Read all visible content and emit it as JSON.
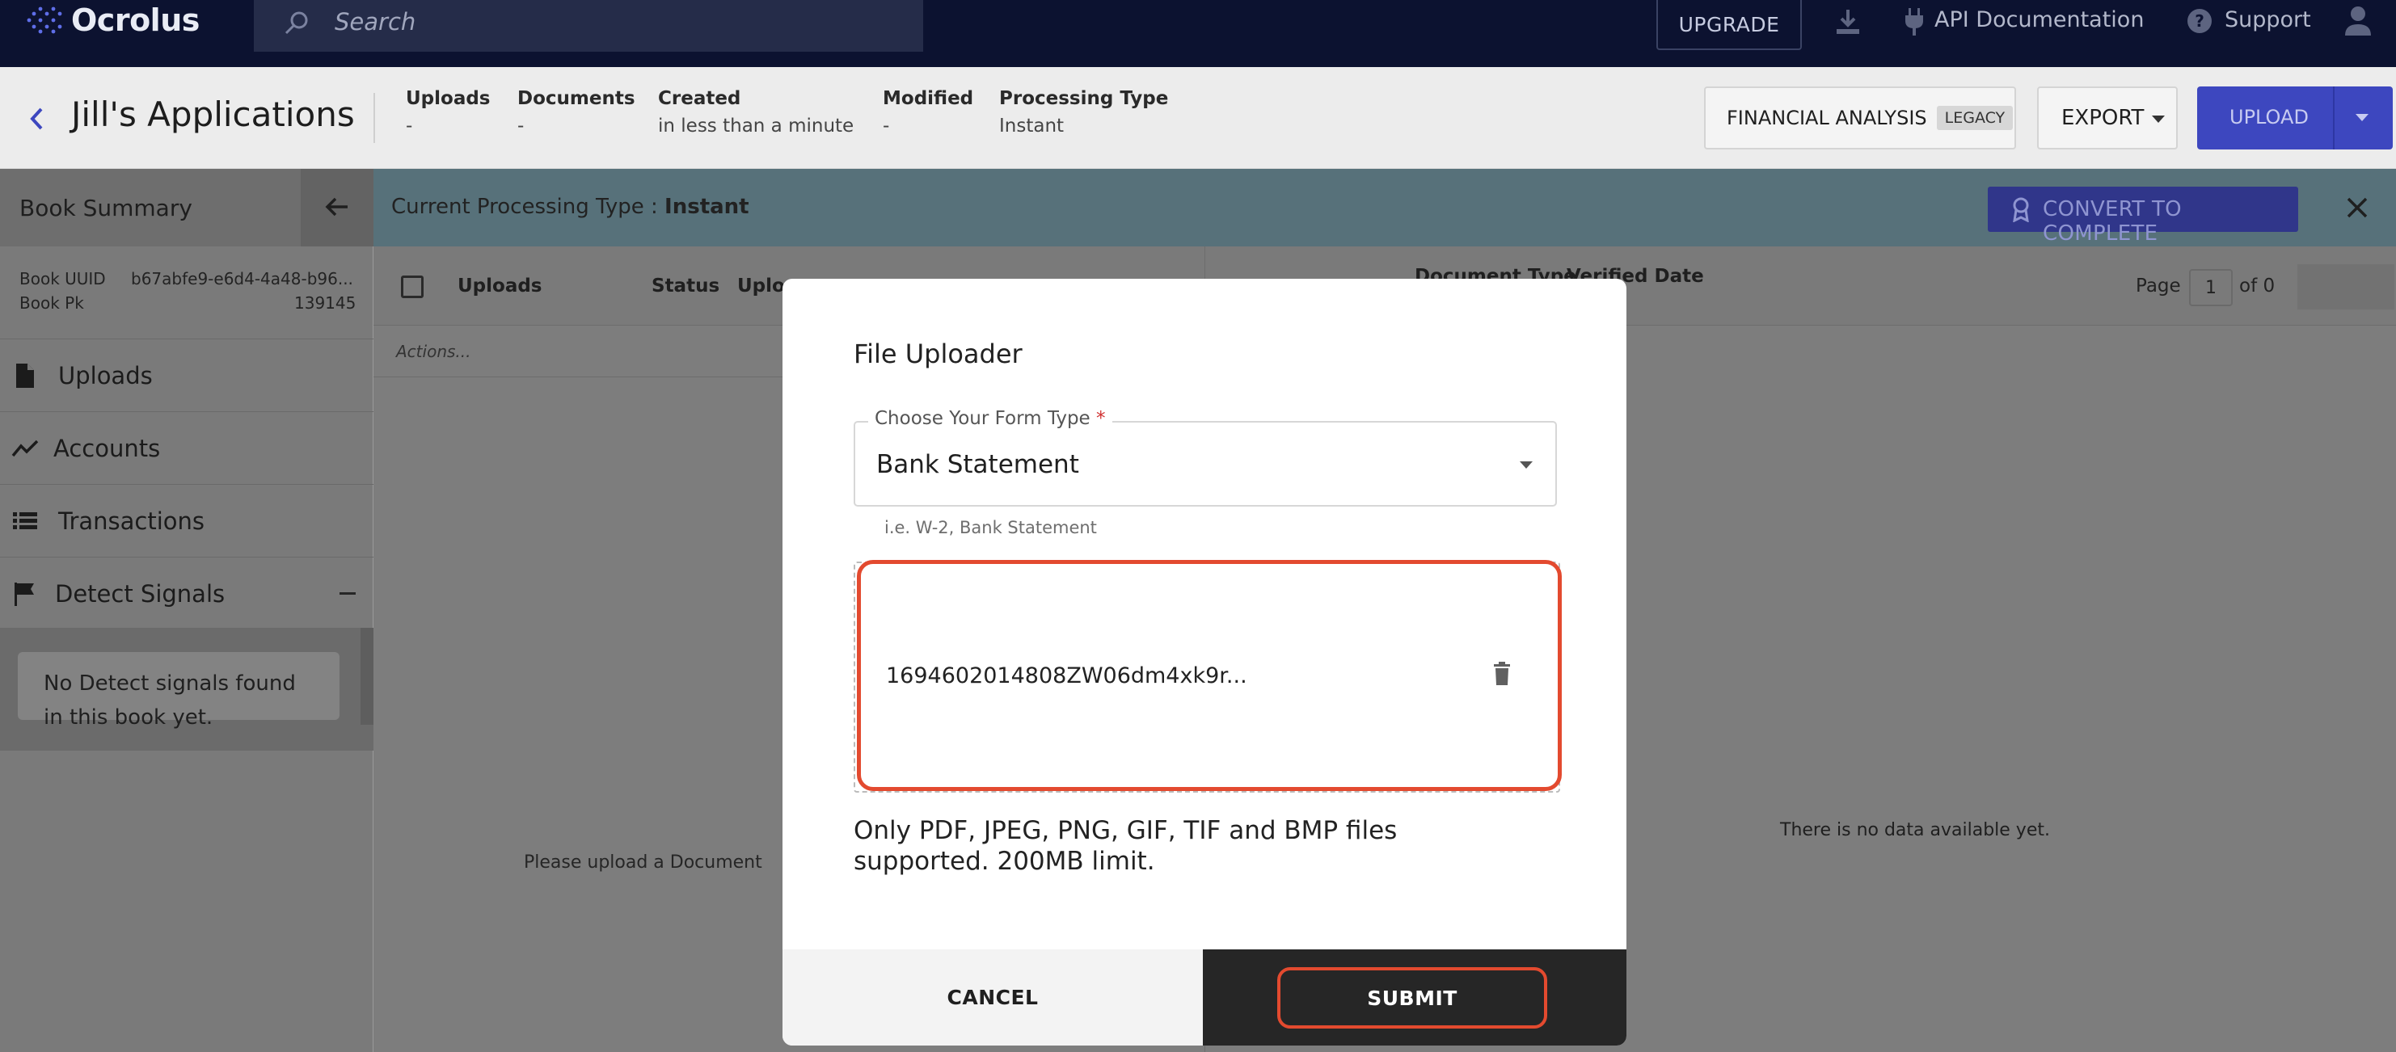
{
  "topnav": {
    "logo_text": "Ocrolus",
    "search_placeholder": "Search",
    "upgrade_label": "UPGRADE",
    "api_docs_label": "API Documentation",
    "support_label": "Support",
    "icons": [
      "download-icon",
      "plug-icon",
      "help-circle-icon",
      "user-icon",
      "search-icon"
    ]
  },
  "header": {
    "title": "Jill's Applications",
    "meta": [
      {
        "label": "Uploads",
        "value": "-"
      },
      {
        "label": "Documents",
        "value": "-"
      },
      {
        "label": "Created",
        "value": "in less than a minute"
      },
      {
        "label": "Modified",
        "value": "-"
      },
      {
        "label": "Processing Type",
        "value": "Instant"
      }
    ],
    "financial_analysis_label": "FINANCIAL ANALYSIS",
    "legacy_badge": "LEGACY",
    "export_label": "EXPORT",
    "upload_label": "UPLOAD"
  },
  "sidebar": {
    "title": "Book Summary",
    "book_uuid_label": "Book UUID",
    "book_uuid_value": "b67abfe9-e6d4-4a48-b96...",
    "book_pk_label": "Book Pk",
    "book_pk_value": "139145",
    "items": [
      {
        "label": "Uploads",
        "icon": "document-icon"
      },
      {
        "label": "Accounts",
        "icon": "trend-line-icon"
      },
      {
        "label": "Transactions",
        "icon": "list-icon"
      },
      {
        "label": "Detect Signals",
        "icon": "flag-icon"
      }
    ],
    "signals_empty": "No Detect signals found in this book yet."
  },
  "content": {
    "banner_prefix": "Current Processing Type : ",
    "banner_value": "Instant",
    "convert_label": "CONVERT TO COMPLETE",
    "columns_left": [
      "Uploads",
      "Status",
      "Uplo"
    ],
    "columns_right": [
      "Document Type",
      "Verified Date"
    ],
    "page_label": "Page",
    "page_value": "1",
    "page_of": "of 0",
    "actions_label": "Actions...",
    "empty_left": "Please upload a Document",
    "empty_right": "There is no data available yet."
  },
  "modal": {
    "title": "File Uploader",
    "form_type_label": "Choose Your Form Type",
    "required_mark": "*",
    "form_type_value": "Bank Statement",
    "helper": "i.e. W-2, Bank Statement",
    "file_name": "1694602014808ZW06dm4xk9r...",
    "note": "Only PDF, JPEG, PNG, GIF, TIF and BMP files supported. 200MB limit.",
    "cancel_label": "CANCEL",
    "submit_label": "SUBMIT"
  },
  "colors": {
    "nav_bg": "#0c1230",
    "primary": "#3d47bf",
    "highlight": "#e34a2f",
    "submit_bg": "#262626"
  }
}
